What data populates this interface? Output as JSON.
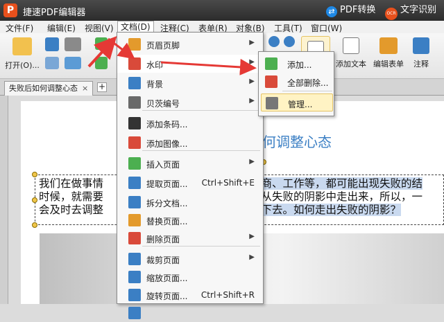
{
  "title_bar": {
    "logo": "P",
    "app_title": "捷速PDF编辑器",
    "pdf_convert": "PDF转换",
    "ocr_icon": "OCR",
    "ocr_label": "文字识别"
  },
  "menubar": [
    "文件(F)",
    "编辑(E)",
    "视图(V)",
    "文档(D)",
    "注释(C)",
    "表单(R)",
    "对象(B)",
    "工具(T)",
    "窗口(W)"
  ],
  "toolbar": {
    "open": "打开(O)...",
    "add_text": "添加文本",
    "edit_form": "编辑表单",
    "annotate": "注释"
  },
  "tab": {
    "doc_name": "失败后如何调整心态",
    "close": "×",
    "new": "+"
  },
  "document": {
    "heading": "何调整心态",
    "lines": [
      [
        "我们在做事情",
        "",
        "经商、工作等，都可能出现失败的结"
      ],
      [
        "时候，就需要",
        "已从失败的阴影中走出来，所以，一",
        ""
      ],
      [
        "会及时去调整",
        "沉下去。如何走出失败的阴影？",
        ""
      ]
    ]
  },
  "menu_document": [
    {
      "label": "页眉页脚",
      "shortcut": "",
      "submenu": true,
      "icon": "header-footer-icon",
      "color": "#e39a2c"
    },
    {
      "label": "水印",
      "shortcut": "",
      "submenu": true,
      "icon": "watermark-icon",
      "color": "#d94a3a",
      "active": true
    },
    {
      "label": "背景",
      "shortcut": "",
      "submenu": true,
      "icon": "background-icon",
      "color": "#3b7fc4"
    },
    {
      "label": "贝茨编号",
      "shortcut": "",
      "submenu": true,
      "icon": "bates-number-icon",
      "color": "#6a6a6a"
    },
    {
      "label": "添加条码...",
      "shortcut": "",
      "submenu": false,
      "icon": "barcode-icon",
      "color": "#333333"
    },
    {
      "label": "添加图像...",
      "shortcut": "",
      "submenu": false,
      "icon": "image-icon",
      "color": "#d94a3a"
    },
    {
      "label": "插入页面",
      "shortcut": "",
      "submenu": true,
      "icon": "insert-page-icon",
      "color": "#4caf50"
    },
    {
      "label": "提取页面...",
      "shortcut": "Ctrl+Shift+E",
      "submenu": false,
      "icon": "extract-page-icon",
      "color": "#3b7fc4"
    },
    {
      "label": "拆分文档...",
      "shortcut": "",
      "submenu": false,
      "icon": "split-doc-icon",
      "color": "#3b7fc4"
    },
    {
      "label": "替换页面...",
      "shortcut": "",
      "submenu": false,
      "icon": "replace-page-icon",
      "color": "#e39a2c"
    },
    {
      "label": "删除页面",
      "shortcut": "",
      "submenu": true,
      "icon": "delete-page-icon",
      "color": "#d94a3a"
    },
    {
      "label": "裁剪页面",
      "shortcut": "",
      "submenu": true,
      "icon": "crop-page-icon",
      "color": "#3b7fc4"
    },
    {
      "label": "缩放页面...",
      "shortcut": "",
      "submenu": false,
      "icon": "scale-page-icon",
      "color": "#3b7fc4"
    },
    {
      "label": "旋转页面...",
      "shortcut": "Ctrl+Shift+R",
      "submenu": false,
      "icon": "rotate-page-icon",
      "color": "#3b7fc4"
    },
    {
      "label": "",
      "shortcut": "",
      "submenu": false,
      "icon": "page-icon",
      "color": "#3b7fc4"
    }
  ],
  "submenu_watermark": [
    {
      "label": "添加...",
      "icon": "watermark-add-icon",
      "color": "#4caf50"
    },
    {
      "label": "全部删除...",
      "icon": "watermark-delete-icon",
      "color": "#d94a3a"
    },
    {
      "label": "管理...",
      "icon": "watermark-manage-icon",
      "color": "#777777",
      "hot": true
    }
  ],
  "colors": {
    "accent_red": "#e8501c",
    "heading_blue": "#3b7fc4",
    "highlight": "#c9d9ef",
    "arrow_red": "#e53935"
  }
}
